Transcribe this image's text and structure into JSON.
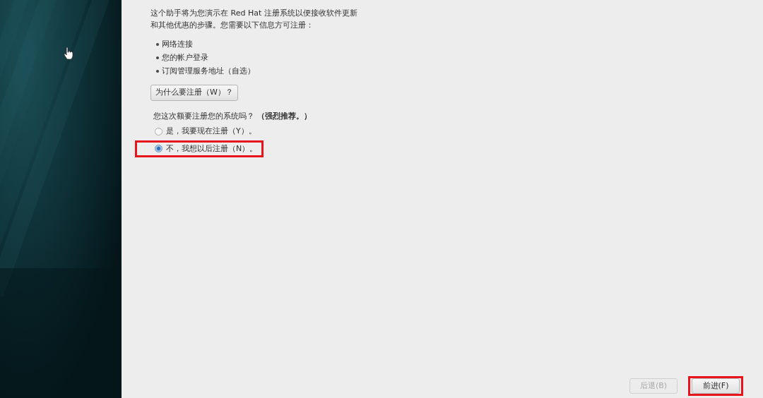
{
  "sidebar": {
    "kind": "picture"
  },
  "intro_lines": [
    "这个助手将为您演示在 Red Hat 注册系统以便接收软件更新",
    "和其他优惠的步骤。您需要以下信息方可注册："
  ],
  "requirements": [
    "网络连接",
    "您的帐户登录",
    "订阅管理服务地址（自选）"
  ],
  "why_button": {
    "label": "为什么要注册（W）？"
  },
  "question": "您这次额要注册您的系统吗？ **（强烈推荐。）**",
  "options": [
    {
      "label": "是，我要现在注册（Y）。",
      "selected": false,
      "highlighted": false
    },
    {
      "label": "不，我想以后注册（N）。",
      "selected": true,
      "highlighted": true
    }
  ],
  "buttons": [
    {
      "label": "后退(B)",
      "disabled": true,
      "highlighted": false
    },
    {
      "label": "前进(F)",
      "disabled": false,
      "highlighted": true
    }
  ]
}
